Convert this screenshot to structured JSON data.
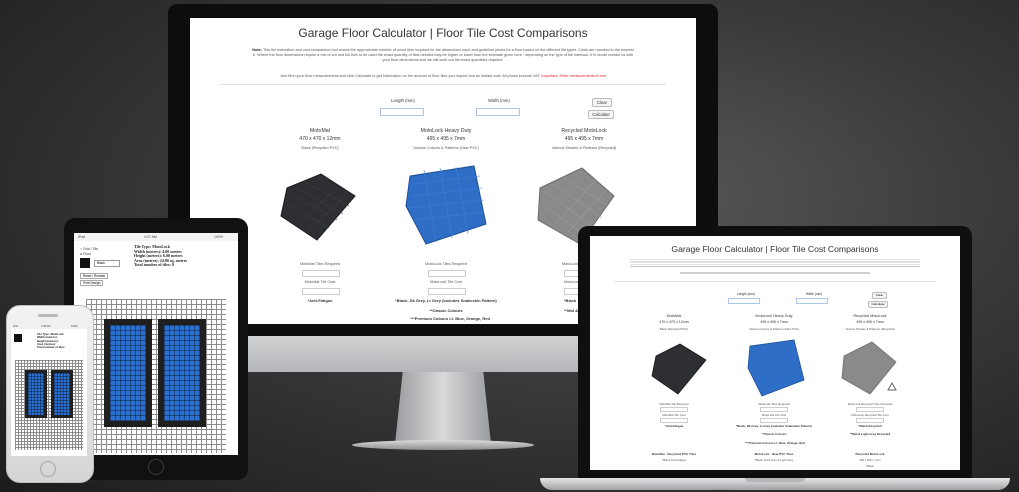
{
  "site": {
    "title": "Garage Floor Calculator | Floor Tile Cost Comparisons",
    "note_label": "Note:",
    "note_text": "This tile estimation and cost comparison tool shows the approximate number of uncut tiles required for the dimensions input and guideline prices for a floor based on the different tile types. Costs are rounded to the nearest £. Where the floor dimensions require a mix of cut and full tiles to be used the exact quantity of tiles needed may be higher or lower than the estimate given here - depending on the type of tile interlock. If in doubt contact us with your floor dimensions and we will work out the exact quantities required.",
    "instruction": "Just fill in your floor measurements and click Calculate to get information on the amount of floor tiles you require and an instant cost. All prices exclude VAT.",
    "instruction_red": "Important: Enter measurements in mm",
    "length_label": "Length (mm)",
    "width_label": "Width (mm)",
    "clear_label": "Clear",
    "calculate_label": "Calculate",
    "products": [
      {
        "name": "MotoMat",
        "dims": "470 x 470 x 12mm",
        "material": "Black (Recycled PVC)",
        "tiles_required": "MotoMat Tiles Required",
        "tile_cost": "MotoMat Tile Cost",
        "note": "*Anti-Fatigue",
        "color": "#2e2f33"
      },
      {
        "name": "MotoLock Heavy Duty",
        "dims": "495 x 495 x 7mm",
        "material": "Various Colours & Patterns (New PVC)",
        "tiles_required": "MotoLock Tiles Required",
        "tile_cost": "MotoLock Tile Cost",
        "note": "*Black, Dk Grey, Lt Grey (includes Snakeskin Pattern)",
        "note2": "**Classic Colours",
        "color": "#2f6ec7"
      },
      {
        "name": "Recycled MotoLock",
        "dims": "495 x 495 x 7mm",
        "material": "Various Shades & Patterns (Recycled)",
        "tiles_required": "MotoLock Recy",
        "tile_cost": "MotoLock Re",
        "note": "*Black",
        "note2": "**Mid & Ligh",
        "color": "#8a8a8a"
      }
    ],
    "footer_note": "***Premium Colours Lt. Blue, Orange, Red"
  },
  "ipad": {
    "status_left": "iPad",
    "status_time": "4:37 AM",
    "status_right": "100%",
    "tile_type": "Tile Type: MotoLock",
    "width": "Width (metres): 4.00 metres",
    "height": "Height (metres): 6.00 metres",
    "area": "Area (metres): 24.00 sq. metres",
    "total": "Total number of tiles: 0",
    "radio1": "Grid / Tile",
    "radio2": "Floor",
    "select": "Black",
    "btn1": "Reset / Redraw",
    "btn2": "Print Design"
  },
  "iphone": {
    "status_left": "iPad",
    "status_time": "4:38 AM",
    "status_right": "100%",
    "lines": [
      "Tile Type: MotoLock",
      "Width (metres):",
      "Height (metres):",
      "Area (metres):",
      "Total number of tiles:"
    ]
  },
  "macbook": {
    "title": "Garage Floor Calculator | Floor Tile Cost Comparisons",
    "length_label": "Length (mm)",
    "width_label": "Width (mm)",
    "clear_label": "Clear",
    "calculate_label": "Calculate",
    "products": [
      {
        "name": "MotoMat",
        "dims": "470 x 470 x 12mm",
        "material": "Black (Recycled PVC)",
        "tiles_required": "MotoMat Tile Required",
        "tile_cost": "MotoMat Tile Cost",
        "note": "*Anti-Fatigue",
        "color": "#2e2f33"
      },
      {
        "name": "MotoLock Heavy Duty",
        "dims": "495 x 495 x 7mm",
        "material": "Various Colours & Patterns (New PVC)",
        "tiles_required": "MotoLock Tiles Required",
        "tile_cost": "MotoLock Tile Cost",
        "note": "*Black, Dk Grey, Lt Grey (includes Snakeskin Pattern)",
        "note2": "**Classic Colours",
        "color": "#2f6ec7"
      },
      {
        "name": "Recycled MotoLock",
        "dims": "495 x 495 x 7mm",
        "material": "Various Shades & Patterns (Recycled)",
        "tiles_required": "MotoLock Recycled Tiles Required",
        "tile_cost": "MotoLock Recycled Tile Cost",
        "note": "*Black Recycled",
        "note2": "**Mid & Light Grey Recycled",
        "color": "#8a8a8a"
      }
    ],
    "footer_note": "***Premium Colours Lt. Blue, Orange, Red",
    "bottom_row": [
      "MotoMat - Recycled PVC Tiles",
      "MotoLock - New PVC Tiles",
      "Recycled MotoLock"
    ],
    "bottom_row2": [
      "*Black Anti-Fatigue",
      "*Black, Dark Grey & Light Grey",
      "495 x 495 x 7mm"
    ],
    "bottom_row3": [
      "",
      "",
      "*Black"
    ]
  }
}
